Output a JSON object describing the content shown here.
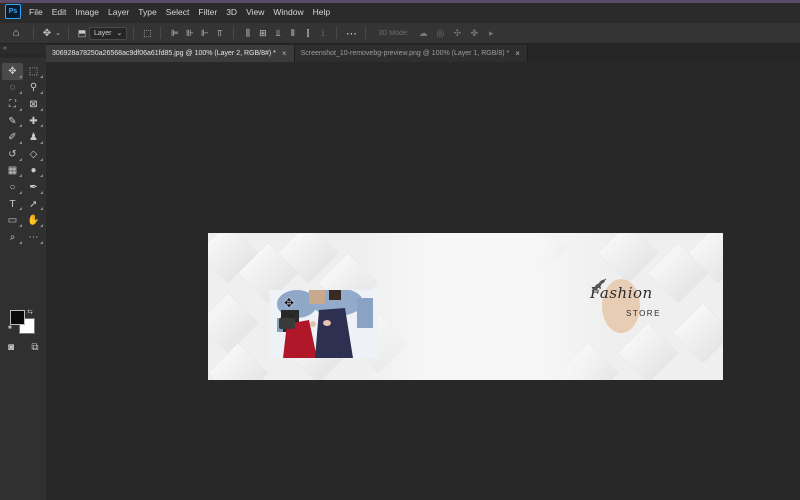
{
  "app": {
    "logo_text": "Ps",
    "brand_color": "#31a8ff"
  },
  "menu": [
    "File",
    "Edit",
    "Image",
    "Layer",
    "Type",
    "Select",
    "Filter",
    "3D",
    "View",
    "Window",
    "Help"
  ],
  "options_bar": {
    "auto_select_value": "Layer",
    "mode_3d_label": "3D Mode:"
  },
  "collapse_label": "«",
  "tabs": [
    {
      "title": "306928a78250a26568ac9df06a61fd85.jpg @ 100% (Layer 2, RGB/8#) *",
      "close": "×",
      "active": true
    },
    {
      "title": "Screenshot_10-removebg-preview.png @ 100% (Layer 1, RGB/8) *",
      "close": "×",
      "active": false
    }
  ],
  "colors": {
    "foreground": "#0a0a0a",
    "background": "#ffffff",
    "canvas_bg": "#f7f7f7",
    "logo_circle": "#e8cdb5"
  },
  "canvas": {
    "logo": {
      "script": "Fashion",
      "subtitle": "STORE"
    }
  },
  "tools": [
    {
      "name": "move-tool-icon",
      "glyph": "✥",
      "active": true
    },
    {
      "name": "marquee-tool-icon",
      "glyph": "⬚"
    },
    {
      "name": "lasso-tool-icon",
      "glyph": "◌"
    },
    {
      "name": "quick-selection-tool-icon",
      "glyph": "⚲"
    },
    {
      "name": "crop-tool-icon",
      "glyph": "⛶"
    },
    {
      "name": "frame-tool-icon",
      "glyph": "⊠"
    },
    {
      "name": "eyedropper-tool-icon",
      "glyph": "✎"
    },
    {
      "name": "healing-brush-tool-icon",
      "glyph": "✚"
    },
    {
      "name": "brush-tool-icon",
      "glyph": "✐"
    },
    {
      "name": "clone-stamp-tool-icon",
      "glyph": "♟"
    },
    {
      "name": "history-brush-tool-icon",
      "glyph": "↺"
    },
    {
      "name": "eraser-tool-icon",
      "glyph": "◇"
    },
    {
      "name": "gradient-tool-icon",
      "glyph": "▦"
    },
    {
      "name": "blur-tool-icon",
      "glyph": "●"
    },
    {
      "name": "dodge-tool-icon",
      "glyph": "○"
    },
    {
      "name": "pen-tool-icon",
      "glyph": "✒"
    },
    {
      "name": "type-tool-icon",
      "glyph": "T"
    },
    {
      "name": "path-selection-tool-icon",
      "glyph": "➚"
    },
    {
      "name": "rectangle-tool-icon",
      "glyph": "▭"
    },
    {
      "name": "hand-tool-icon",
      "glyph": "✋"
    },
    {
      "name": "zoom-tool-icon",
      "glyph": "⌕"
    },
    {
      "name": "more-tools-icon",
      "glyph": "⋯"
    }
  ]
}
